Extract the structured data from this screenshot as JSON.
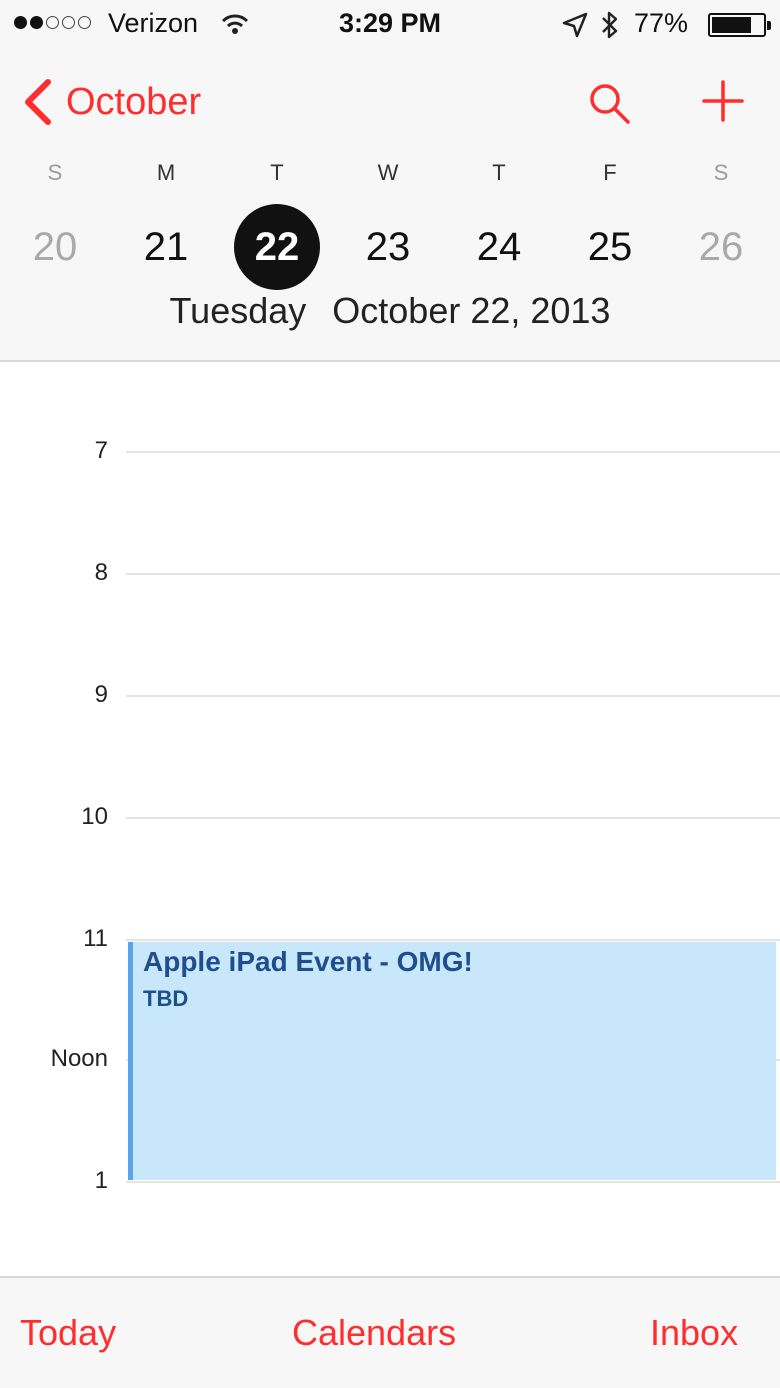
{
  "status_bar": {
    "signal_filled": 2,
    "signal_total": 5,
    "carrier": "Verizon",
    "time": "3:29 PM",
    "battery_pct": "77%",
    "battery_level": 0.77,
    "icons": [
      "wifi-icon",
      "location-arrow-icon",
      "bluetooth-icon",
      "battery-icon"
    ]
  },
  "nav": {
    "back_label": "October",
    "search_icon": "search-icon",
    "add_icon": "plus-icon",
    "accent": "#ff2d2d"
  },
  "week": {
    "days": [
      {
        "letter": "S",
        "num": "20",
        "weekend": true,
        "selected": false
      },
      {
        "letter": "M",
        "num": "21",
        "weekend": false,
        "selected": false
      },
      {
        "letter": "T",
        "num": "22",
        "weekend": false,
        "selected": true
      },
      {
        "letter": "W",
        "num": "23",
        "weekend": false,
        "selected": false
      },
      {
        "letter": "T",
        "num": "24",
        "weekend": false,
        "selected": false
      },
      {
        "letter": "F",
        "num": "25",
        "weekend": false,
        "selected": false
      },
      {
        "letter": "S",
        "num": "26",
        "weekend": true,
        "selected": false
      }
    ],
    "weekday_caption": "Tuesday",
    "date_caption": "October 22, 2013"
  },
  "timeline": {
    "hours": [
      "7",
      "8",
      "9",
      "10",
      "11",
      "Noon",
      "1"
    ],
    "event": {
      "title": "Apple iPad Event - OMG!",
      "location": "TBD",
      "fill_color": "#c9e7fb",
      "text_color": "#1e4f8c"
    }
  },
  "tabs": {
    "today": "Today",
    "calendars": "Calendars",
    "inbox": "Inbox"
  }
}
